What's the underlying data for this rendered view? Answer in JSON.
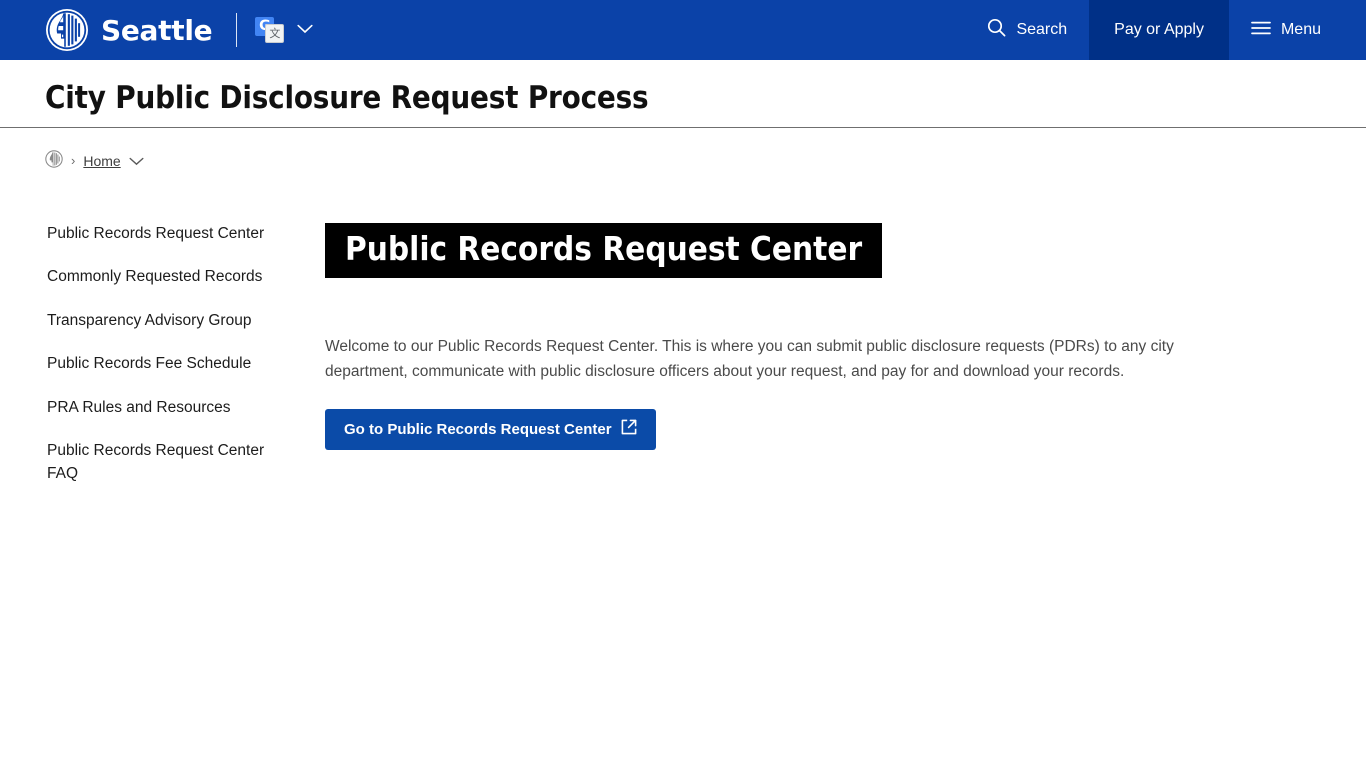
{
  "header": {
    "brand_label": "Seattle",
    "seal_icon": "seattle-city-seal-icon",
    "translate": {
      "icon": "google-translate-icon",
      "g_letter": "G",
      "glyph": "文",
      "chevron_icon": "chevron-down-icon"
    },
    "nav": [
      {
        "label": "Search",
        "icon": "search-icon",
        "style": "plain"
      },
      {
        "label": "Pay or Apply",
        "icon": "",
        "style": "highlight"
      },
      {
        "label": "Menu",
        "icon": "hamburger-menu-icon",
        "style": "menu"
      }
    ]
  },
  "page": {
    "title": "City Public Disclosure Request Process"
  },
  "breadcrumb": {
    "seal_icon": "seattle-seal-small-icon",
    "separator": "›",
    "home_label": "Home",
    "chevron_icon": "chevron-down-icon"
  },
  "sidebar": {
    "items": [
      {
        "label": "Public Records Request Center"
      },
      {
        "label": "Commonly Requested Records"
      },
      {
        "label": "Transparency Advisory Group"
      },
      {
        "label": "Public Records Fee Schedule"
      },
      {
        "label": "PRA Rules and Resources"
      },
      {
        "label": "Public Records Request Center FAQ"
      }
    ]
  },
  "main": {
    "heading": "Public Records Request Center",
    "paragraph": "Welcome to our Public Records Request Center. This is where you can submit public disclosure requests (PDRs) to any city department, communicate with public disclosure officers about your request, and pay for and download your records.",
    "cta": {
      "label": "Go to Public Records Request Center",
      "icon": "external-link-icon"
    }
  },
  "colors": {
    "header_blue": "#0b42a8",
    "nav_highlight_navy": "#003087",
    "cta_blue": "#0b4ba8",
    "heading_black": "#000000",
    "body_text": "#4a4a4a",
    "divider_gray": "#6f6f6f"
  }
}
